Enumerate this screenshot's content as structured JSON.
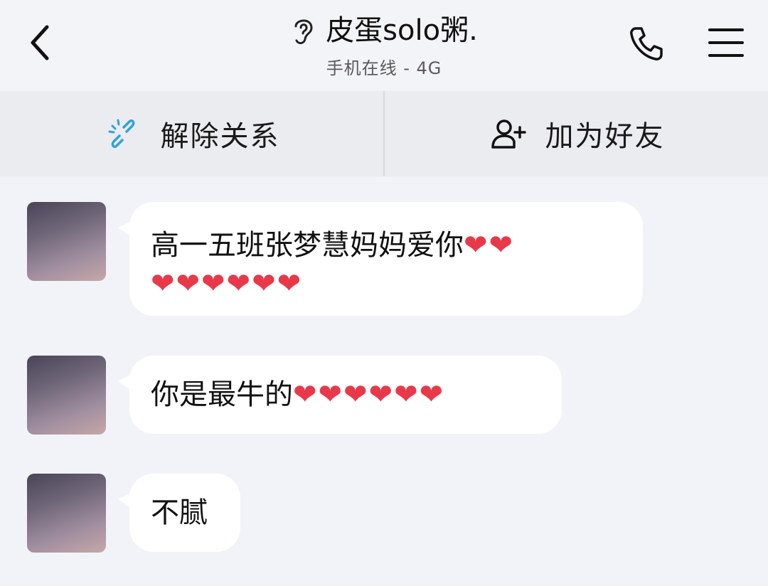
{
  "header": {
    "title": "皮蛋solo粥.",
    "subtitle": "手机在线 - 4G",
    "icons": [
      "back-chevron-icon",
      "ear-icon",
      "phone-icon",
      "menu-icon"
    ]
  },
  "actions": {
    "unbind_label": "解除关系",
    "add_friend_label": "加为好友",
    "accent_color": "#2fa3d8"
  },
  "messages": [
    {
      "text": "高一五班张梦慧妈妈爱你",
      "hearts_line1": "❤❤",
      "hearts_line2": "❤❤❤❤❤❤"
    },
    {
      "text": "你是最牛的",
      "hearts": "❤❤❤❤❤❤"
    },
    {
      "text": "不腻"
    }
  ]
}
